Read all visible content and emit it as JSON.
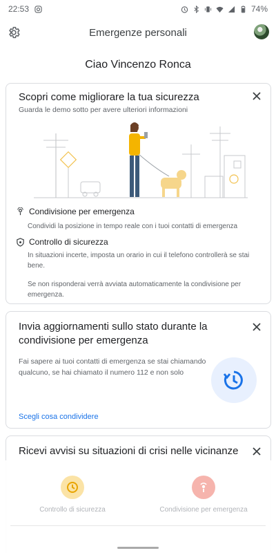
{
  "status_bar": {
    "time": "22:53",
    "battery": "74%"
  },
  "app_bar": {
    "title": "Emergenze personali"
  },
  "greeting": "Ciao Vincenzo Ronca",
  "card1": {
    "title": "Scopri come migliorare la tua sicurezza",
    "subtitle": "Guarda le demo sotto per avere ulteriori informazioni",
    "features": [
      {
        "icon": "location-pin-icon",
        "title": "Condivisione per emergenza",
        "body": "Condividi la posizione in tempo reale con i tuoi contatti di emergenza"
      },
      {
        "icon": "shield-icon",
        "title": "Controllo di sicurezza",
        "body": "In situazioni incerte, imposta un orario in cui il telefono controllerà se stai bene.",
        "body2": "Se non risponderai verrà avviata automaticamente la condivisione per emergenza."
      }
    ]
  },
  "card2": {
    "title": "Invia aggiornamenti sullo stato durante la condivisione per emergenza",
    "body": "Fai sapere ai tuoi contatti di emergenza se stai chiamando qualcuno, se hai chiamato il numero 112 e non solo",
    "link": "Scegli cosa condividere"
  },
  "card3": {
    "title": "Ricevi avvisi su situazioni di crisi nelle vicinanze"
  },
  "bottom_actions": [
    {
      "label": "Controllo di sicurezza",
      "icon": "safety-check-icon",
      "color": "#fbe3a6"
    },
    {
      "label": "Condivisione per emergenza",
      "icon": "emergency-sharing-icon",
      "color": "#f6b4ad"
    }
  ],
  "colors": {
    "accent": "#1a73e8",
    "text": "#202124",
    "muted": "#5f6368"
  }
}
